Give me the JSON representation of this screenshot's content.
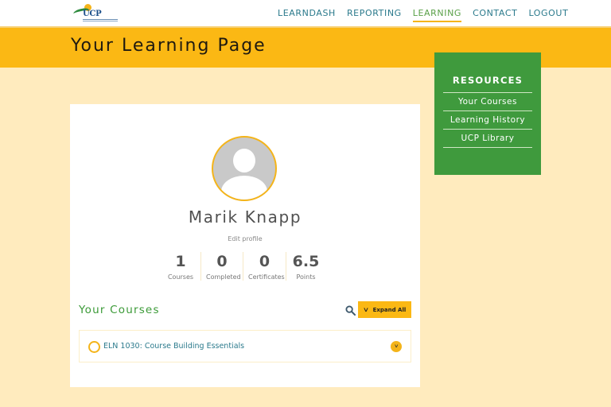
{
  "header": {
    "logo_text": "UCP",
    "nav": [
      {
        "label": "LEARNDASH",
        "active": false
      },
      {
        "label": "REPORTING",
        "active": false
      },
      {
        "label": "LEARNING",
        "active": true
      },
      {
        "label": "CONTACT",
        "active": false
      },
      {
        "label": "LOGOUT",
        "active": false
      }
    ]
  },
  "hero": {
    "title": "Your Learning Page"
  },
  "resources": {
    "title": "RESOURCES",
    "links": [
      "Your Courses",
      "Learning History",
      "UCP Library"
    ]
  },
  "profile": {
    "name": "Marik Knapp",
    "edit_label": "Edit profile",
    "stats": [
      {
        "value": "1",
        "label": "Courses"
      },
      {
        "value": "0",
        "label": "Completed"
      },
      {
        "value": "0",
        "label": "Certificates"
      },
      {
        "value": "6.5",
        "label": "Points"
      }
    ]
  },
  "courses": {
    "title": "Your Courses",
    "expand_all_label": "Expand All",
    "search_icon": "search-icon",
    "items": [
      {
        "name": "ELN 1030: Course Building Essentials",
        "status": "not-started"
      }
    ]
  },
  "colors": {
    "accent_yellow": "#fbb814",
    "green": "#3f9a3d",
    "teal_link": "#2b7a8c",
    "page_bg": "#ffebbe"
  }
}
